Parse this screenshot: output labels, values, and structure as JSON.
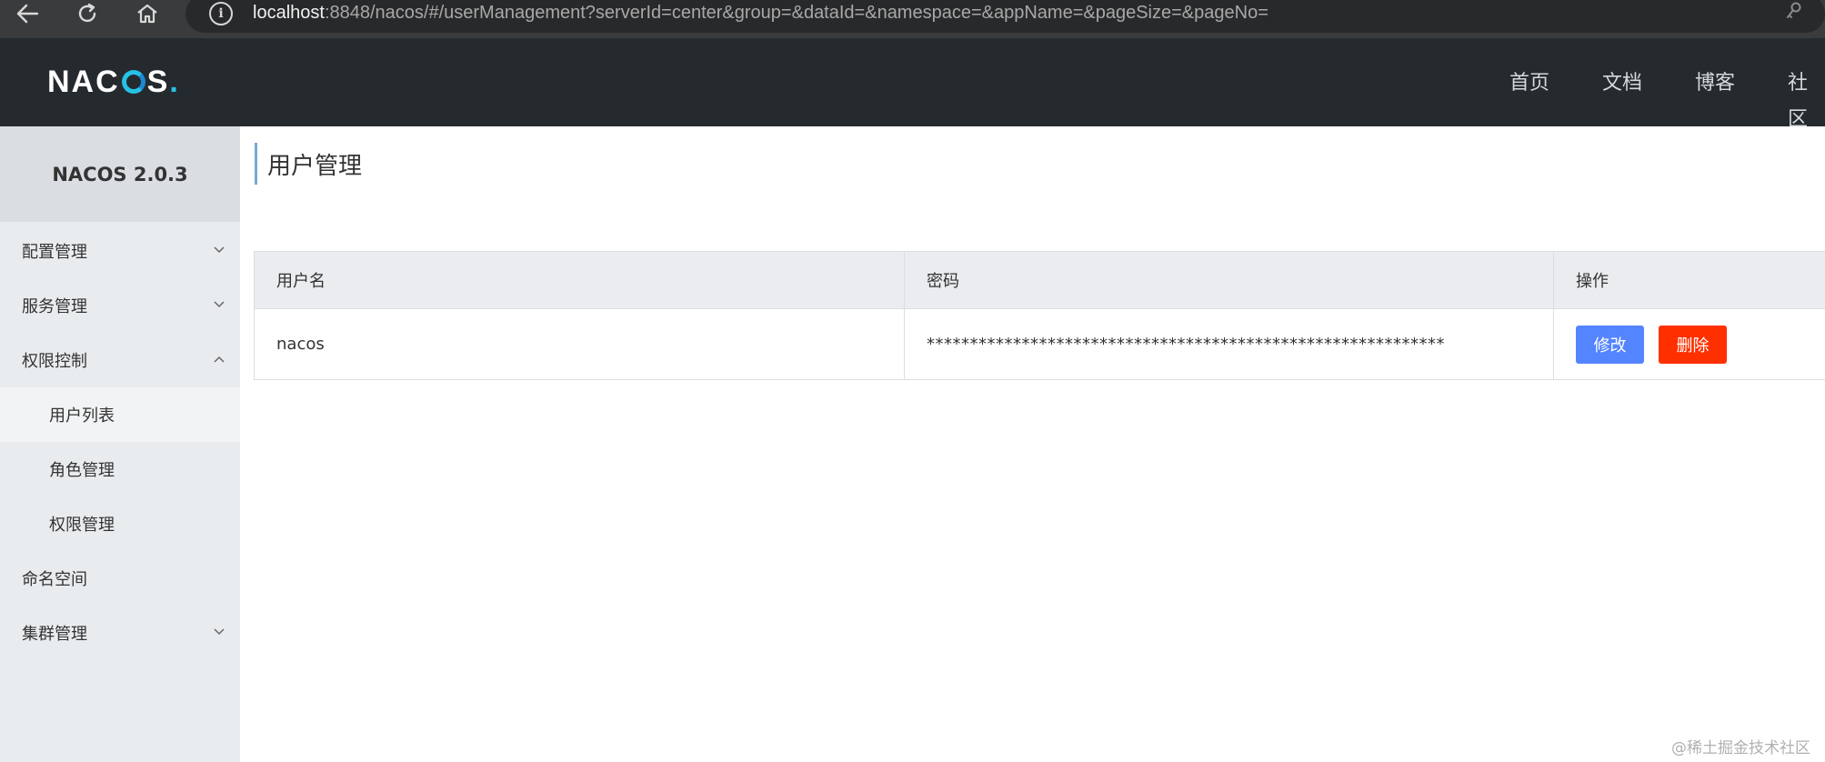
{
  "browser": {
    "url_host": "localhost",
    "url_rest": ":8848/nacos/#/userManagement?serverId=center&group=&dataId=&namespace=&appName=&pageSize=&pageNo="
  },
  "header": {
    "logo_prefix": "NA",
    "logo_suffix": "S",
    "logo_dot": ".",
    "nav": [
      "首页",
      "文档",
      "博客",
      "社区"
    ]
  },
  "sidebar": {
    "brand": "NACOS 2.0.3",
    "items": [
      {
        "label": "配置管理",
        "chevron": "down"
      },
      {
        "label": "服务管理",
        "chevron": "down"
      },
      {
        "label": "权限控制",
        "chevron": "up"
      },
      {
        "label": "用户列表",
        "active": true
      },
      {
        "label": "角色管理"
      },
      {
        "label": "权限管理"
      },
      {
        "label": "命名空间"
      },
      {
        "label": "集群管理",
        "chevron": "down"
      }
    ]
  },
  "main": {
    "title": "用户管理",
    "table": {
      "columns": [
        "用户名",
        "密码",
        "操作"
      ],
      "rows": [
        {
          "username": "nacos",
          "password": "************************************************************",
          "edit_label": "修改",
          "delete_label": "删除"
        }
      ]
    }
  },
  "watermark": "@稀土掘金技术社区",
  "colors": {
    "header_bg": "#252a2f",
    "sidebar_bg": "#e9ecef",
    "edit_button": "#5584ff",
    "delete_button": "#ff3000",
    "logo_accent": "#27c1e6"
  }
}
